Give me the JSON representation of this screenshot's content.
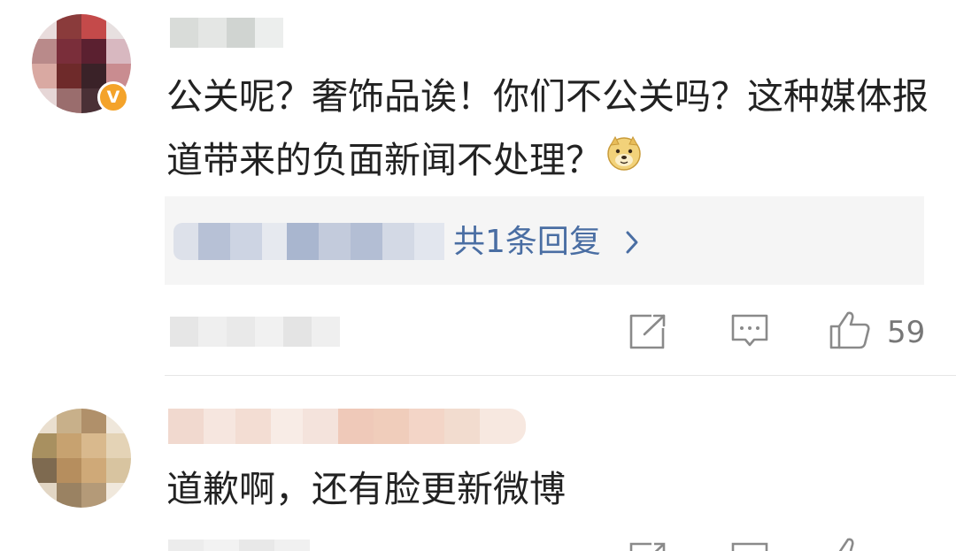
{
  "comments": [
    {
      "text": "公关呢？奢饰品诶！你们不公关吗？这种媒体报道带来的负面新闻不处理？",
      "emoji": "doge-emoji",
      "verified_badge": "V",
      "replies_label": "共1条回复",
      "like_count": "59",
      "actions": [
        "share-icon",
        "comment-icon",
        "like-icon"
      ]
    },
    {
      "text": "道歉啊，还有脸更新微博",
      "actions": [
        "share-icon",
        "comment-icon",
        "like-icon"
      ]
    }
  ],
  "colors": {
    "link": "#4a6ea3",
    "text": "#222222",
    "meta": "#777777",
    "reply_bg": "#f5f5f5",
    "badge": "#f4a32a"
  }
}
